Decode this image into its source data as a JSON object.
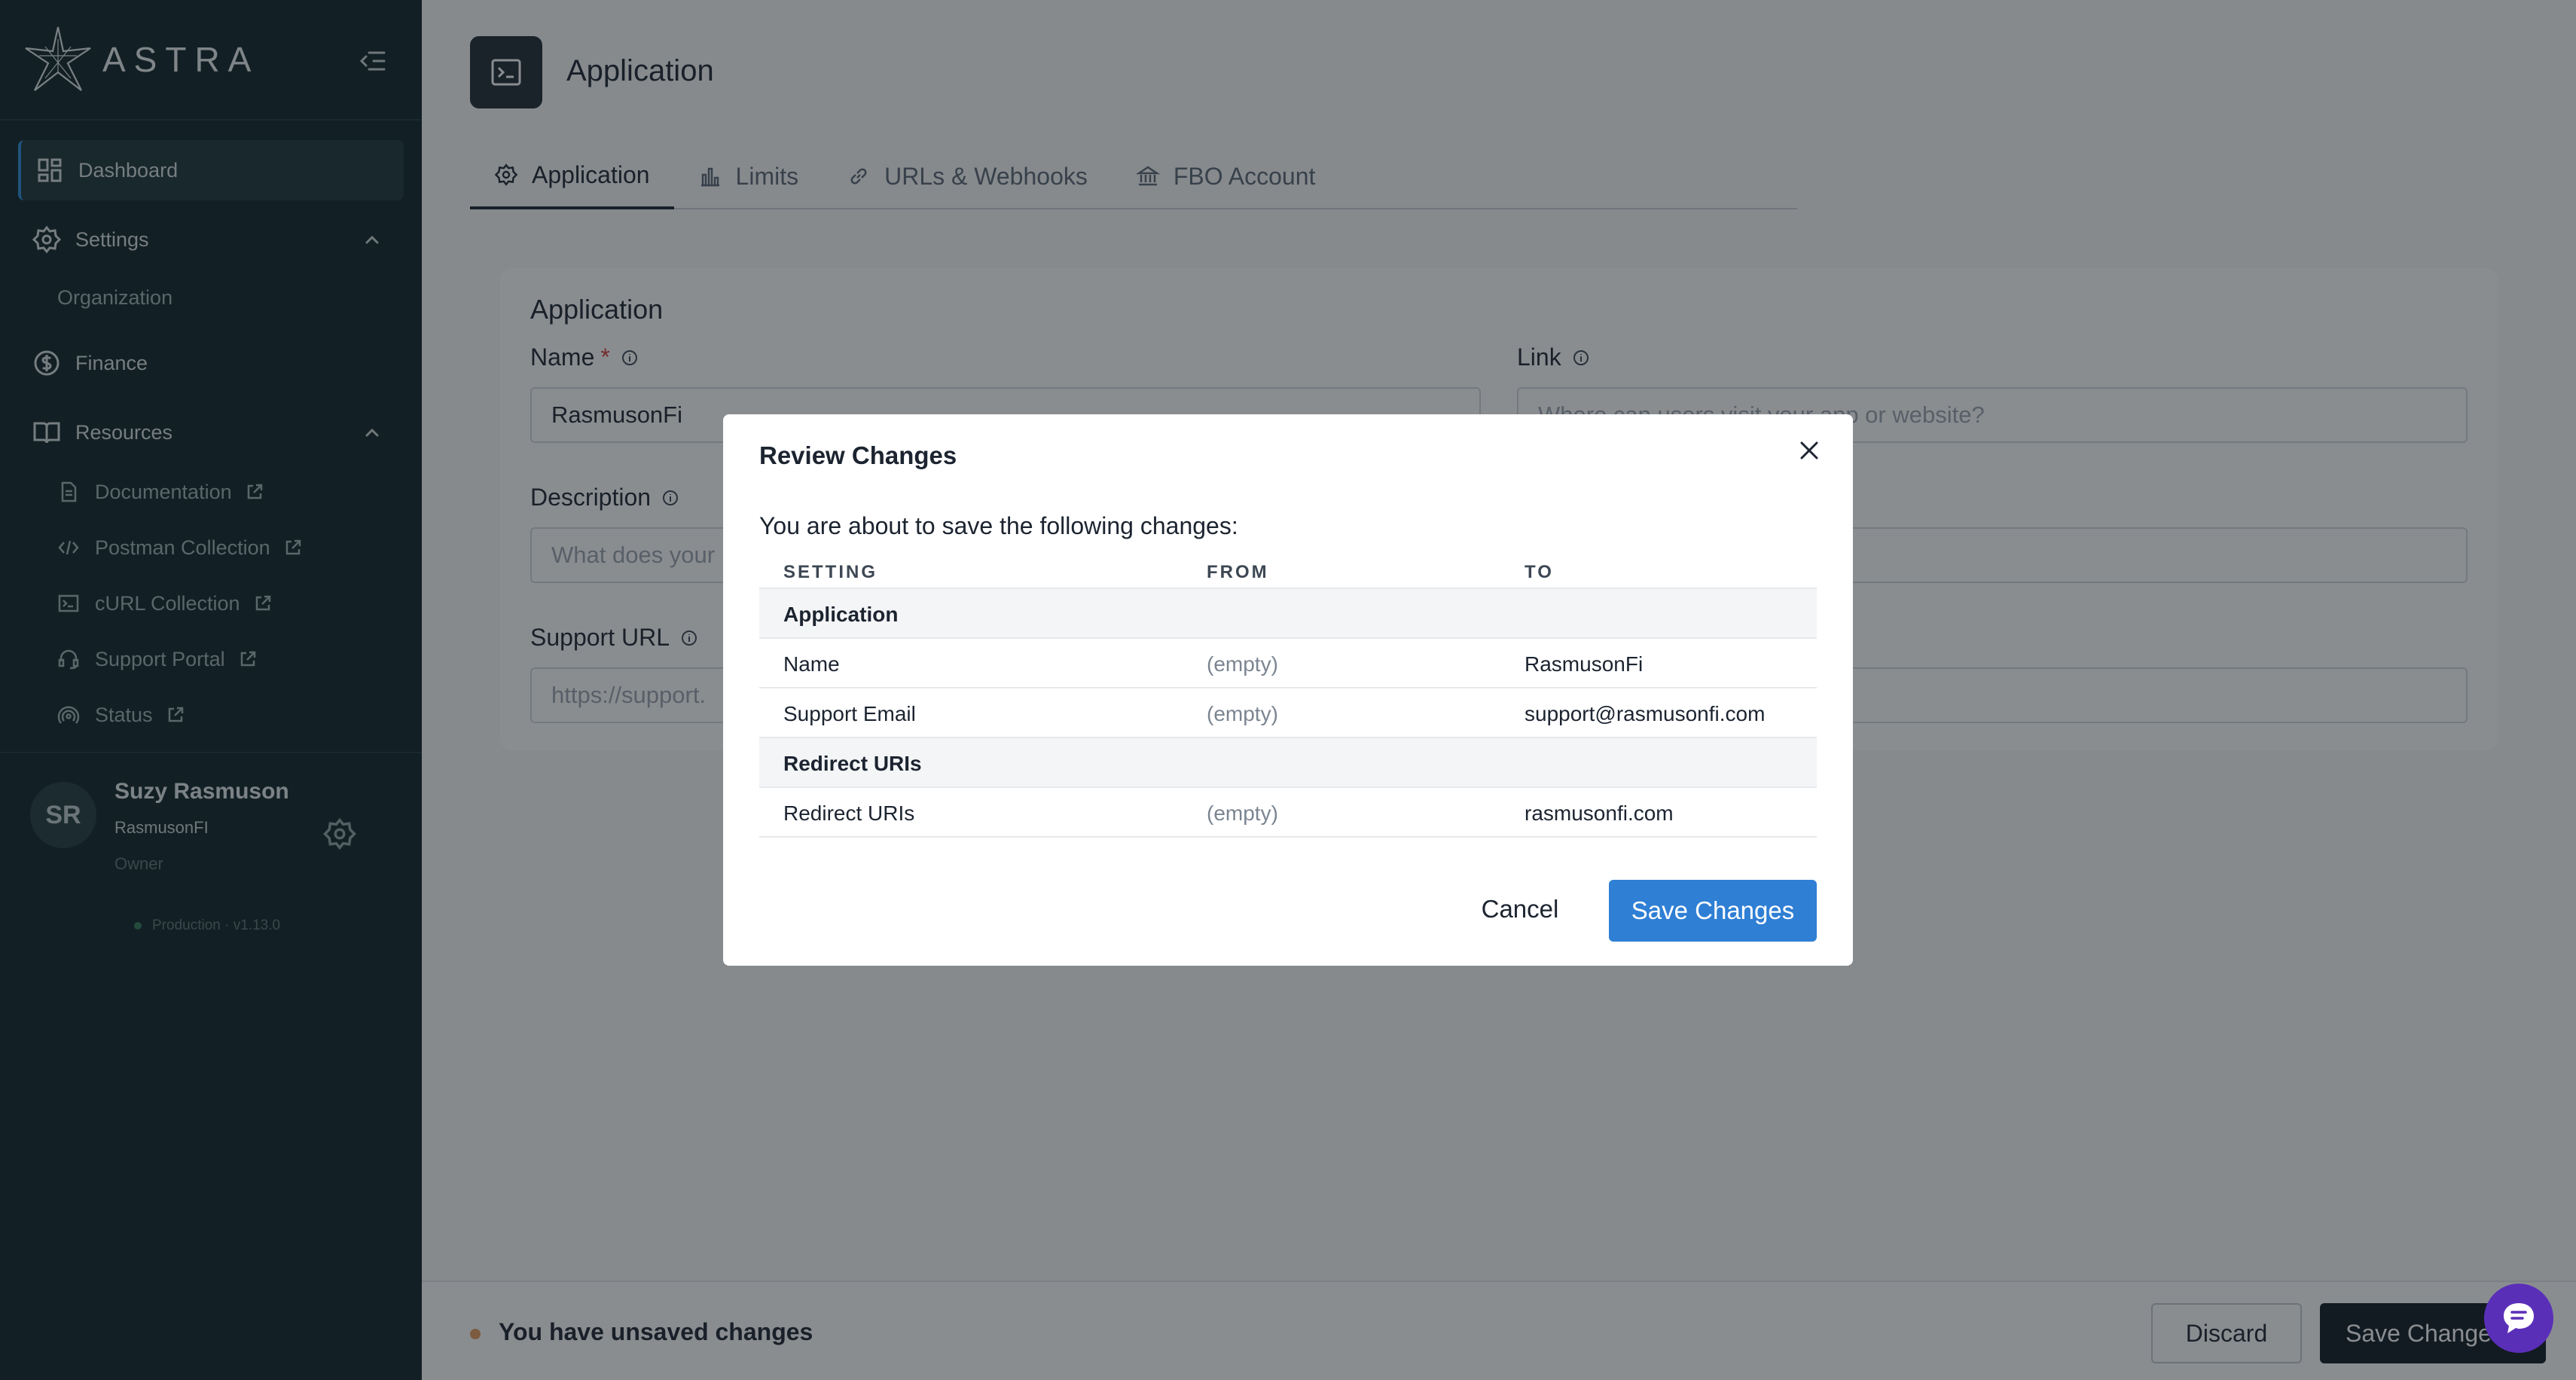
{
  "app": {
    "logo_text": "ASTRA"
  },
  "sidebar": {
    "nav": [
      {
        "label": "Dashboard",
        "icon": "dashboard-grid-icon",
        "active": true
      },
      {
        "label": "Settings",
        "icon": "gear-icon",
        "expanded": true,
        "children": [
          {
            "label": "Organization"
          }
        ]
      },
      {
        "label": "Finance",
        "icon": "dollar-circle-icon"
      },
      {
        "label": "Resources",
        "icon": "book-icon",
        "expanded": true,
        "children": [
          {
            "label": "Documentation",
            "icon": "document-icon",
            "external": true
          },
          {
            "label": "Postman Collection",
            "icon": "code-brackets-icon",
            "external": true
          },
          {
            "label": "cURL Collection",
            "icon": "terminal-icon",
            "external": true
          },
          {
            "label": "Support Portal",
            "icon": "headset-icon",
            "external": true
          },
          {
            "label": "Status",
            "icon": "signal-icon",
            "external": true
          }
        ]
      }
    ],
    "user": {
      "initials": "SR",
      "name": "Suzy Rasmuson",
      "org": "RasmusonFI",
      "role": "Owner"
    },
    "environment": "Production · v1.13.0"
  },
  "header": {
    "title": "Application"
  },
  "tabs": [
    {
      "label": "Application",
      "icon": "gear-icon",
      "active": true
    },
    {
      "label": "Limits",
      "icon": "bar-chart-icon"
    },
    {
      "label": "URLs & Webhooks",
      "icon": "link-icon"
    },
    {
      "label": "FBO Account",
      "icon": "bank-icon"
    }
  ],
  "form": {
    "section_title": "Application",
    "name": {
      "label": "Name",
      "required_marker": "*",
      "value": "RasmusonFi"
    },
    "link": {
      "label": "Link",
      "placeholder": "Where can users visit your app or website?"
    },
    "description": {
      "label": "Description",
      "placeholder": "What does your"
    },
    "support_url": {
      "label": "Support URL",
      "placeholder": "https://support."
    }
  },
  "bottom_bar": {
    "unsaved_text": "You have unsaved changes",
    "discard_label": "Discard",
    "save_label": "Save Changes"
  },
  "modal": {
    "title": "Review Changes",
    "intro": "You are about to save the following changes:",
    "columns": [
      "SETTING",
      "FROM",
      "TO"
    ],
    "rows": [
      {
        "type": "group",
        "setting": "Application"
      },
      {
        "type": "change",
        "setting": "Name",
        "from": "(empty)",
        "to": "RasmusonFi"
      },
      {
        "type": "change",
        "setting": "Support Email",
        "from": "(empty)",
        "to": "support@rasmusonfi.com"
      },
      {
        "type": "group",
        "setting": "Redirect URIs"
      },
      {
        "type": "change",
        "setting": "Redirect URIs",
        "from": "(empty)",
        "to": "rasmusonfi.com"
      }
    ],
    "cancel_label": "Cancel",
    "save_label": "Save Changes"
  },
  "colors": {
    "sidebar_bg": "#0e2428",
    "primary": "#2f7fd4",
    "required": "#d23b3b",
    "chat": "#5a2fb8"
  }
}
